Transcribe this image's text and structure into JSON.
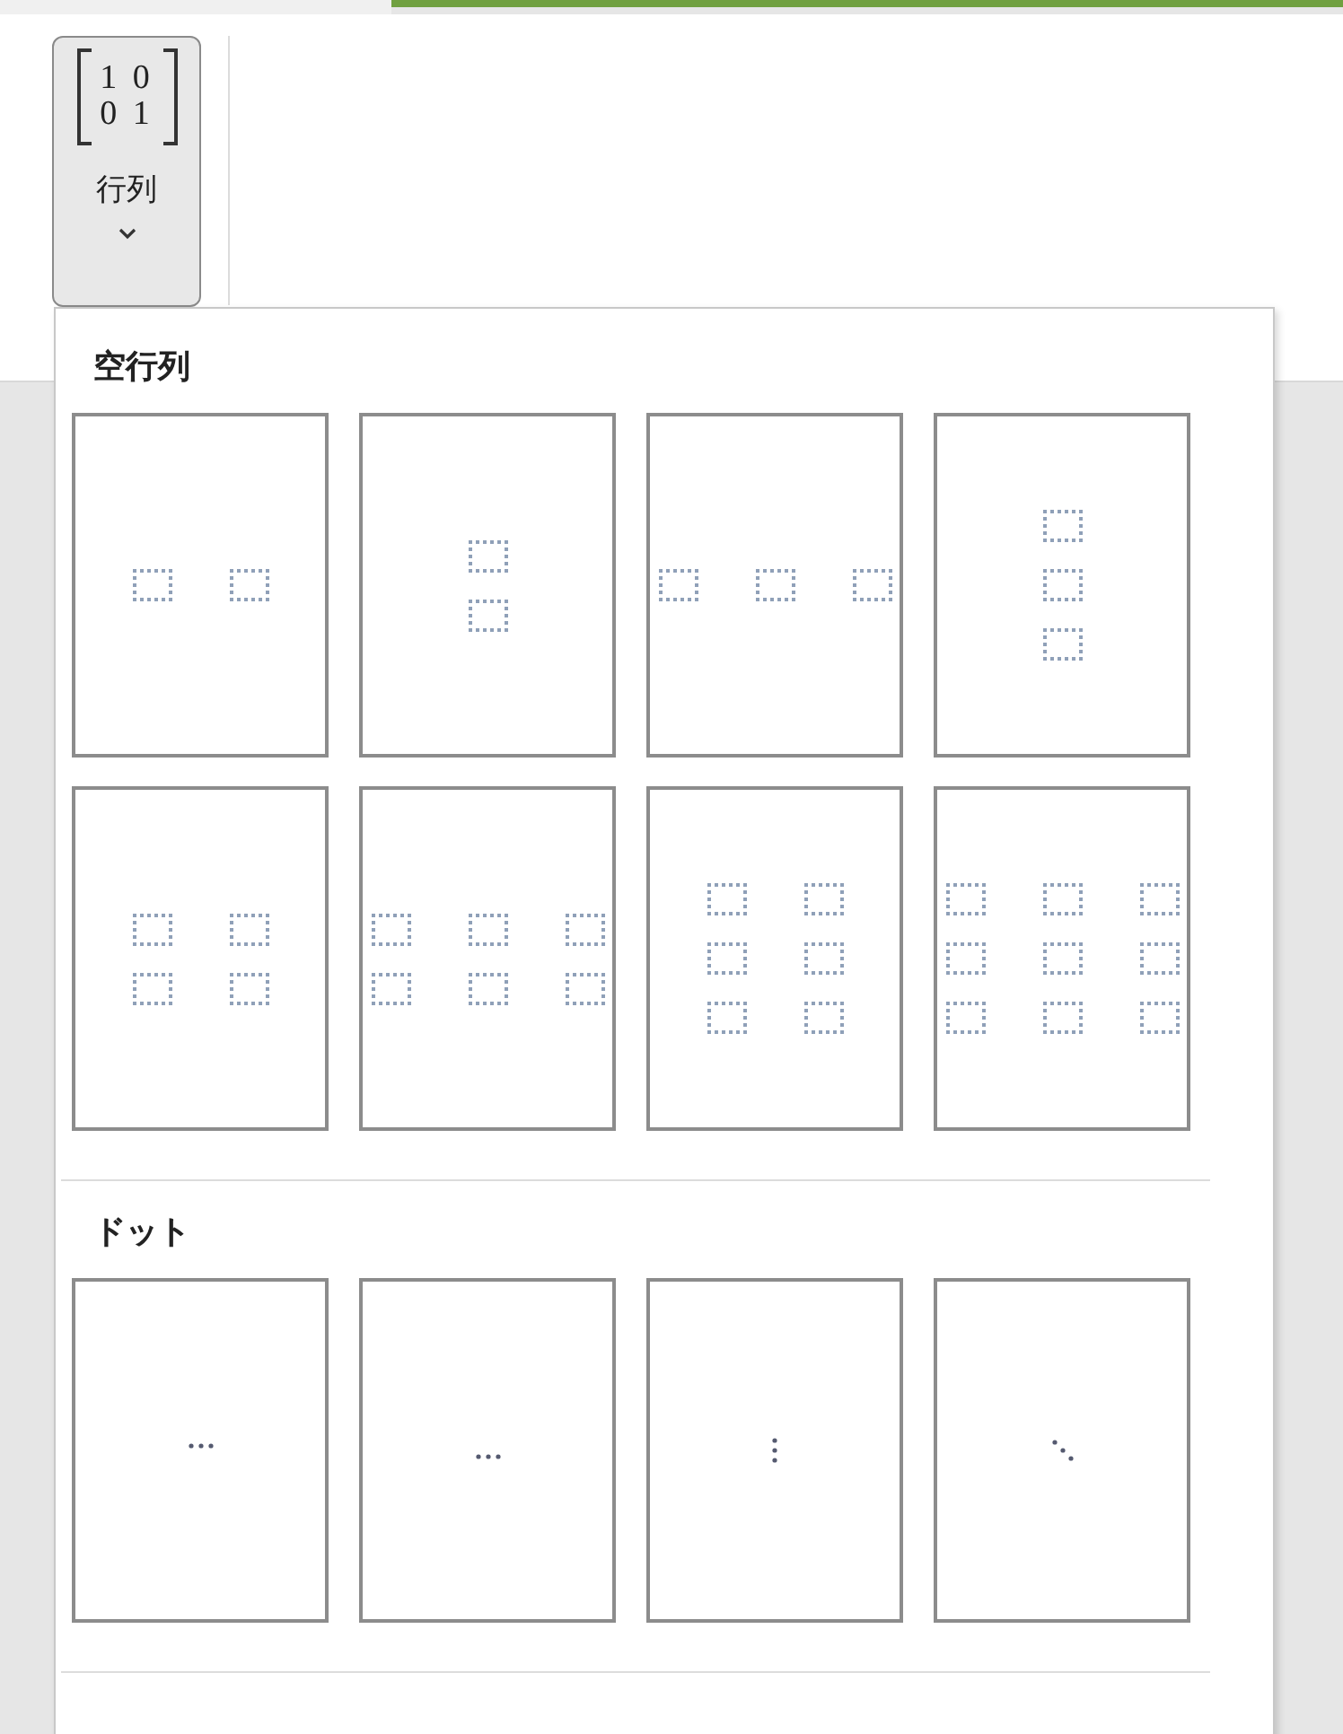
{
  "ribbon_button": {
    "icon_rows": [
      "1 0",
      "0 1"
    ],
    "label": "行列",
    "expanded": true
  },
  "sections": [
    {
      "heading": "空行列",
      "tiles": [
        {
          "kind": "grid-1x2"
        },
        {
          "kind": "grid-2x1"
        },
        {
          "kind": "grid-1x3"
        },
        {
          "kind": "grid-3x1"
        },
        {
          "kind": "grid-2x2"
        },
        {
          "kind": "grid-2x3"
        },
        {
          "kind": "grid-3x2"
        },
        {
          "kind": "grid-3x3"
        }
      ]
    },
    {
      "heading": "ドット",
      "tiles": [
        {
          "kind": "dots-midline"
        },
        {
          "kind": "dots-baseline"
        },
        {
          "kind": "dots-vertical"
        },
        {
          "kind": "dots-diagonal"
        }
      ]
    }
  ]
}
